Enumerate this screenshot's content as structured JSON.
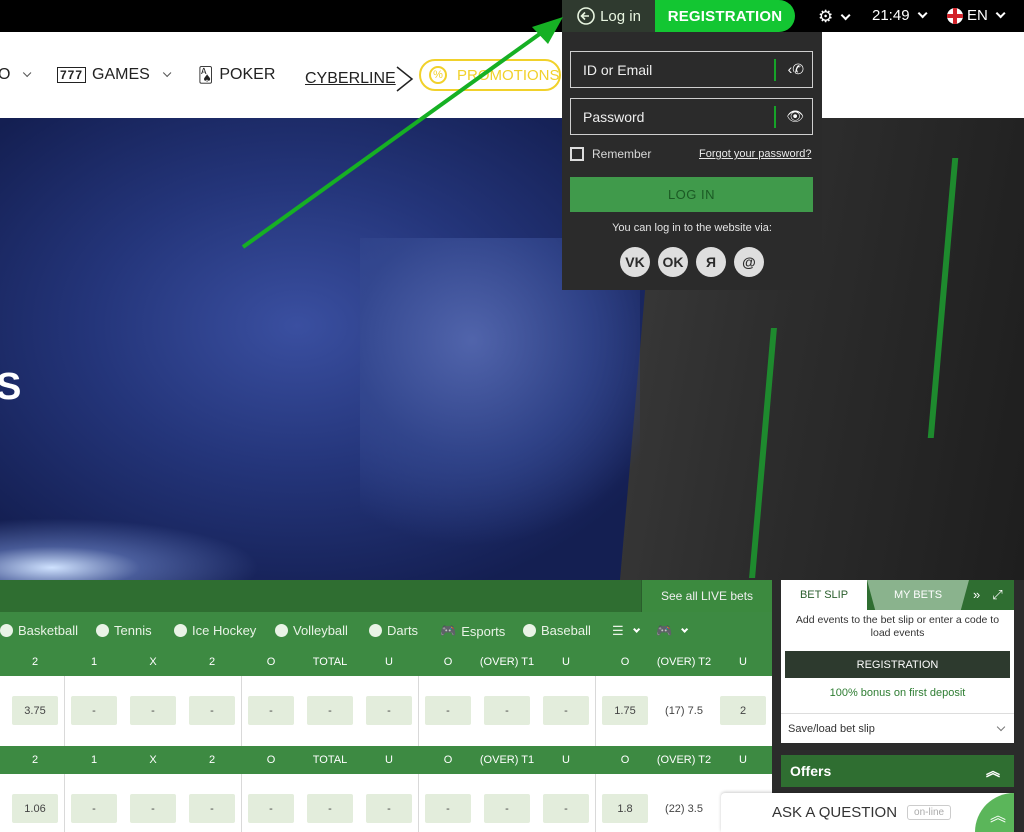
{
  "topbar": {
    "login_label": "Log in",
    "registration_label": "REGISTRATION",
    "time": "21:49",
    "language": "EN"
  },
  "nav": {
    "casino_fragment": "O",
    "games": "GAMES",
    "poker": "POKER",
    "cyberline": "CYBERLINE",
    "promotions": "PROMOTIONS"
  },
  "hero": {
    "letter": "S"
  },
  "login_panel": {
    "id_placeholder": "ID or Email",
    "password_placeholder": "Password",
    "remember": "Remember",
    "forgot": "Forgot your password?",
    "login_button": "LOG IN",
    "via_text": "You can log in to the website via:",
    "social": [
      "VK",
      "OK",
      "Я",
      "@"
    ]
  },
  "live": {
    "see_all": "See all LIVE bets",
    "sports": [
      "Basketball",
      "Tennis",
      "Ice Hockey",
      "Volleyball",
      "Darts",
      "Esports",
      "Baseball"
    ],
    "columns": [
      "2",
      "1",
      "X",
      "2",
      "O",
      "TOTAL",
      "U",
      "O",
      "(OVER) T1",
      "U",
      "O",
      "(OVER) T2",
      "U"
    ],
    "rows": [
      {
        "values": [
          "3.75",
          "-",
          "-",
          "-",
          "-",
          "-",
          "-",
          "-",
          "-",
          "-",
          "1.75",
          "(17) 7.5",
          "2"
        ]
      },
      {
        "values": [
          "1.06",
          "-",
          "-",
          "-",
          "-",
          "-",
          "-",
          "-",
          "-",
          "-",
          "1.8",
          "(22) 3.5",
          ""
        ]
      }
    ]
  },
  "betslip": {
    "tab_betslip": "BET SLIP",
    "tab_mybets": "MY BETS",
    "info": "Add events to the bet slip or enter a code to load events",
    "registration": "REGISTRATION",
    "bonus": "100% bonus on first deposit",
    "save_load": "Save/load bet slip"
  },
  "offers": {
    "label": "Offers"
  },
  "ask": {
    "label": "ASK A QUESTION",
    "status": "on-line"
  },
  "colors": {
    "accent_green": "#13c632",
    "dark_green": "#2f6e31",
    "promo_yellow": "#f1d12b"
  }
}
